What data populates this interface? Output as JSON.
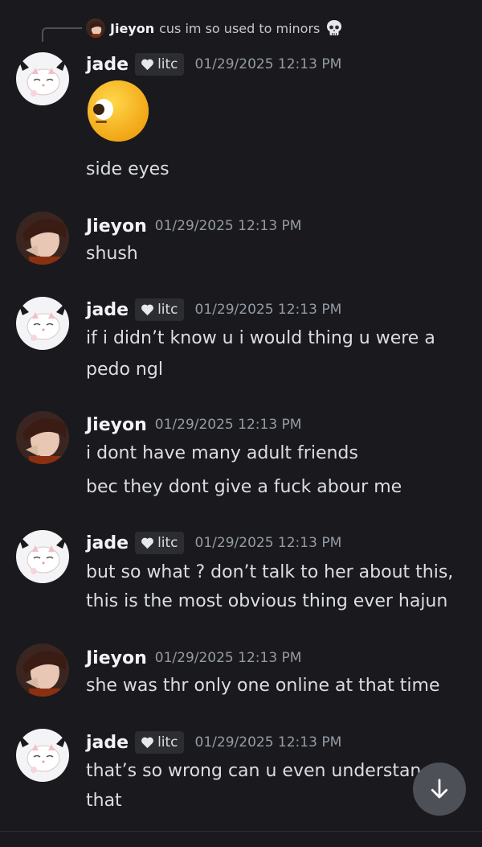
{
  "reply": {
    "author": "Jieyon",
    "text": "cus im so used to minors",
    "emoji": "skull-emoji"
  },
  "messages": [
    {
      "author": "jade",
      "tag": "litc",
      "timestamp": "01/29/2025 12:13 PM",
      "emoji": "side-eye-face-emoji",
      "lines": [
        "side eyes"
      ]
    },
    {
      "author": "Jieyon",
      "timestamp": "01/29/2025 12:13 PM",
      "lines": [
        "shush"
      ]
    },
    {
      "author": "jade",
      "tag": "litc",
      "timestamp": "01/29/2025 12:13 PM",
      "lines": [
        "if i didn’t know u i would thing u were a",
        "pedo ngl"
      ]
    },
    {
      "author": "Jieyon",
      "timestamp": "01/29/2025 12:13 PM",
      "lines": [
        "i dont have many adult friends",
        "bec they dont give a fuck abour me"
      ]
    },
    {
      "author": "jade",
      "tag": "litc",
      "timestamp": "01/29/2025 12:13 PM",
      "lines": [
        "but so what ? don’t talk to her about this,",
        "this is the most obvious thing ever hajun"
      ]
    },
    {
      "author": "Jieyon",
      "timestamp": "01/29/2025 12:13 PM",
      "lines": [
        "she was thr only one online at that time"
      ]
    },
    {
      "author": "jade",
      "tag": "litc",
      "timestamp": "01/29/2025 12:13 PM",
      "lines": [
        "that’s so wrong can u even understan",
        "that"
      ]
    }
  ],
  "scroll_button": {
    "icon": "arrow-down-icon"
  },
  "colors": {
    "background": "#1a1a1e",
    "text": "#dbdee1",
    "author": "#f2f3f5",
    "timestamp": "#949ba4",
    "tag_bg": "#2b2d31",
    "scroll_btn": "#4e5058"
  }
}
